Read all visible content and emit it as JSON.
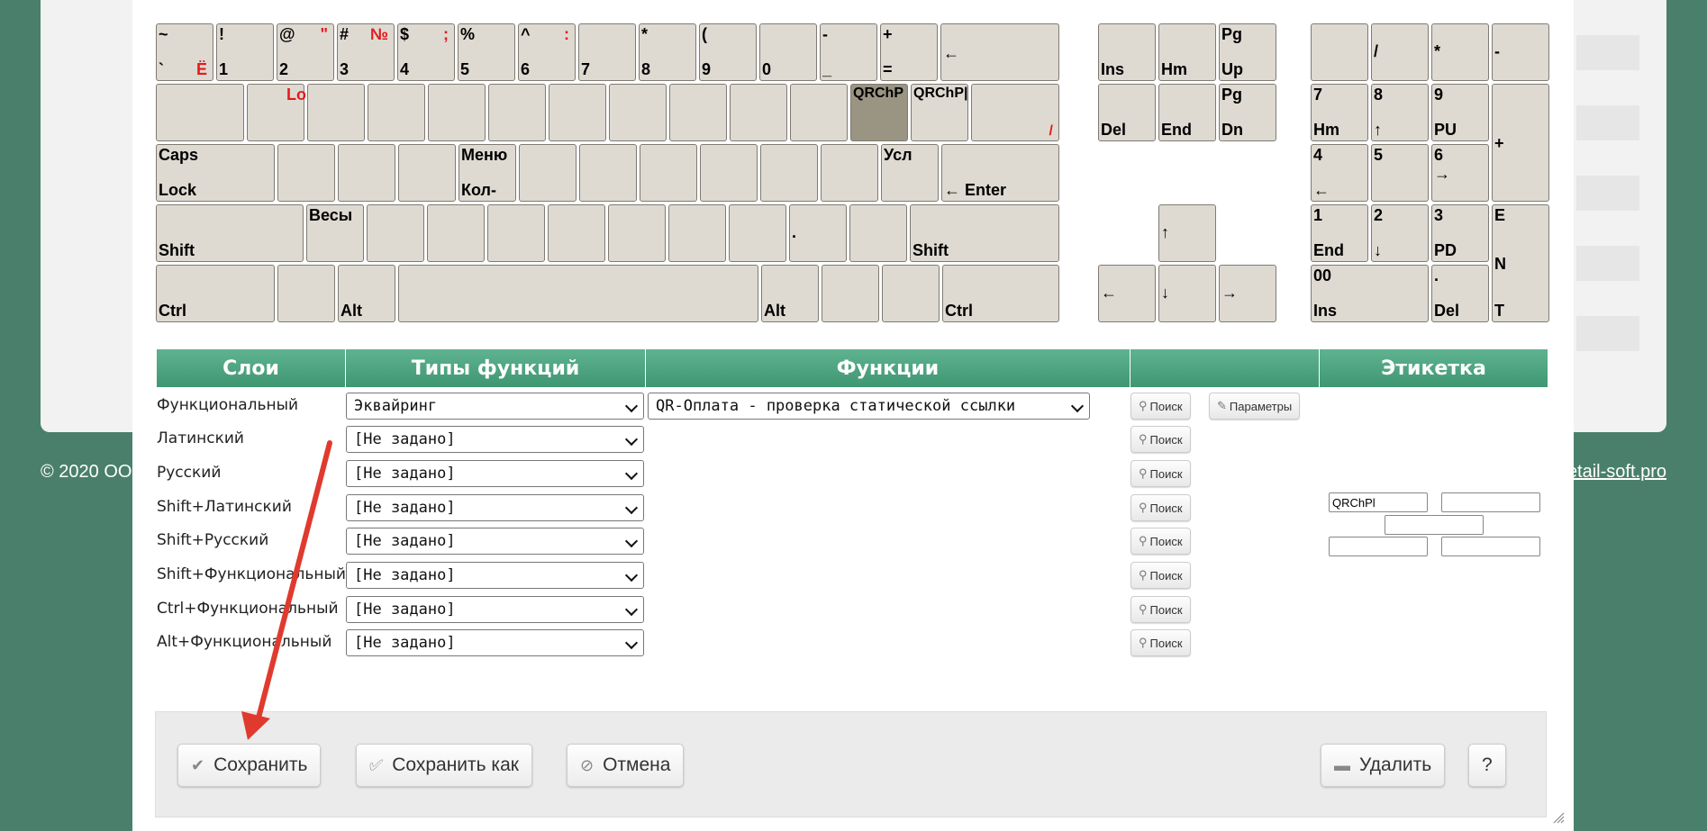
{
  "footer": {
    "copyright": "© 2020 ОО",
    "link": "etail-soft.pro"
  },
  "keyboard": {
    "selected_key": "QRChP",
    "keys": {
      "tilde": {
        "top": "~",
        "bottom": "`",
        "red_bottom": "Ё"
      },
      "k1": {
        "top": "!",
        "bottom": "1"
      },
      "k2": {
        "top": "@",
        "bottom": "2",
        "red_top": "\""
      },
      "k3": {
        "top": "#",
        "bottom": "3",
        "red_top": "№"
      },
      "k4": {
        "top": "$",
        "bottom": "4",
        "red_top": ";"
      },
      "k5": {
        "top": "%",
        "bottom": "5"
      },
      "k6": {
        "top": "^",
        "bottom": "6",
        "red_top": ":"
      },
      "k7": {
        "top": "",
        "bottom": "7"
      },
      "k8": {
        "top": "*",
        "bottom": "8"
      },
      "k9": {
        "top": "(",
        "bottom": "9"
      },
      "k0": {
        "top": "",
        "bottom": "0"
      },
      "minus": {
        "top": "-",
        "bottom": "_"
      },
      "plus": {
        "top": "+",
        "bottom": "="
      },
      "backspace": {
        "middle": "←"
      },
      "tab_red": "Lo",
      "qrchp1": "QRChP",
      "qrchp2": "QRChP|",
      "backslash_red": "/",
      "caps": {
        "top": "Caps",
        "bottom": "Lock"
      },
      "menu": {
        "top": "Меню",
        "bottom": "Кол-"
      },
      "usl": "Усл",
      "enter": "← Enter",
      "shift_l": "Shift",
      "vesy": "Весы",
      "dot": ".",
      "shift_r": "Shift",
      "ctrl_l": "Ctrl",
      "alt_l": "Alt",
      "alt_r": "Alt",
      "ctrl_r": "Ctrl",
      "ins": "Ins",
      "hm": "Hm",
      "pgup": {
        "top": "Pg",
        "bottom": "Up"
      },
      "del": "Del",
      "end": "End",
      "pgdn": {
        "top": "Pg",
        "bottom": "Dn"
      },
      "up": "↑",
      "left": "←",
      "down": "↓",
      "right": "→",
      "np_slash": "/",
      "np_star": "*",
      "np_minus": "-",
      "np7": {
        "top": "7",
        "bottom": "Hm"
      },
      "np8": {
        "top": "8",
        "bottom": "↑"
      },
      "np9": {
        "top": "9",
        "bottom": "PU"
      },
      "np_plus": "+",
      "np4": {
        "top": "4",
        "bottom": "←"
      },
      "np5": "5",
      "np6": {
        "top": "6",
        "bottom": "→"
      },
      "np1": {
        "top": "1",
        "bottom": "End"
      },
      "np2": {
        "top": "2",
        "bottom": "↓"
      },
      "np3": {
        "top": "3",
        "bottom": "PD"
      },
      "np_enter": {
        "a": "E",
        "b": "N",
        "c": "T"
      },
      "np0": {
        "top": "00",
        "bottom": "Ins"
      },
      "np_dot": {
        "top": ".",
        "bottom": "Del"
      }
    }
  },
  "table": {
    "headers": [
      "Слои",
      "Типы функций",
      "Функции",
      "",
      "Этикетка"
    ],
    "rows": [
      {
        "layer": "Функциональный",
        "type": "Эквайринг",
        "function": "QR-Оплата - проверка статической ссылки"
      },
      {
        "layer": "Латинский",
        "type": "[Не задано]"
      },
      {
        "layer": "Русский",
        "type": "[Не задано]"
      },
      {
        "layer": "Shift+Латинский",
        "type": "[Не задано]"
      },
      {
        "layer": "Shift+Русский",
        "type": "[Не задано]"
      },
      {
        "layer": "Shift+Функциональный",
        "type": "[Не задано]"
      },
      {
        "layer": "Ctrl+Функциональный",
        "type": "[Не задано]"
      },
      {
        "layer": "Alt+Функциональный",
        "type": "[Не задано]"
      }
    ],
    "search_label": "Поиск",
    "params_label": "Параметры",
    "label_field_value": "QRChPl"
  },
  "actions": {
    "save": "Сохранить",
    "save_as": "Сохранить как",
    "cancel": "Отмена",
    "delete": "Удалить",
    "help": "?"
  },
  "colors": {
    "header": "#4aa680",
    "background": "#4a806b",
    "key": "#dedad2",
    "selected_key": "#9a9482",
    "annotation_arrow": "#e03a2f"
  }
}
